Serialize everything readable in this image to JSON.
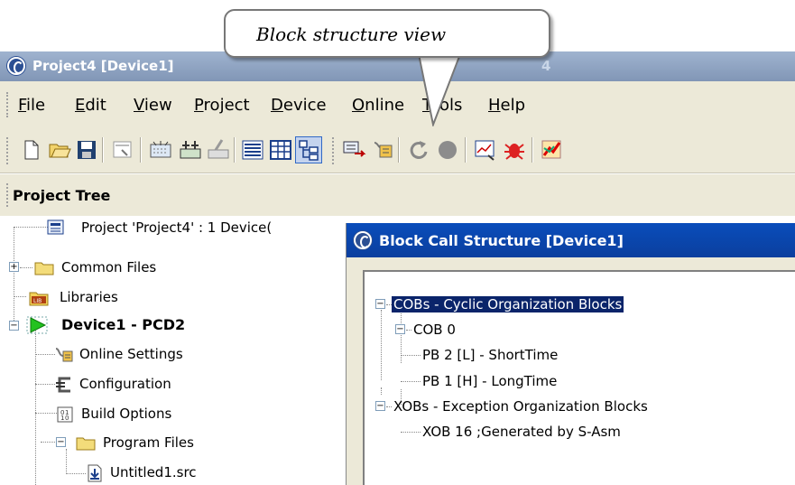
{
  "callout": {
    "text": "Block structure view"
  },
  "window": {
    "title": "Project4 [Device1]",
    "title_tail": "4"
  },
  "menu": [
    "File",
    "Edit",
    "View",
    "Project",
    "Device",
    "Online",
    "Tools",
    "Help"
  ],
  "toolbar_icons": [
    "new-icon",
    "open-icon",
    "save-icon",
    "properties-icon",
    "build-icon",
    "build-all-icon",
    "clean-icon",
    "list-view-icon",
    "table-view-icon",
    "block-structure-icon",
    "online-settings-icon",
    "configurator-icon",
    "restart-icon",
    "stop-icon",
    "watch-window-icon",
    "debugger-icon",
    "fupla-icon"
  ],
  "project_tree": {
    "header": "Project Tree"
  },
  "tree": {
    "project": "Project 'Project4' : 1 Device(",
    "common_files": "Common Files",
    "libraries": "Libraries",
    "device": "Device1 - PCD2",
    "online_settings": "Online Settings",
    "configuration": "Configuration",
    "build_options": "Build Options",
    "program_files": "Program Files",
    "untitled": "Untitled1.src"
  },
  "block_call": {
    "title": "Block Call Structure [Device1]",
    "cobs": "COBs - Cyclic Organization Blocks",
    "cob0": "COB 0",
    "pb2": "PB 2 [L] - ShortTime",
    "pb1": "PB 1 [H] - LongTime",
    "xobs": "XOBs - Exception Organization Blocks",
    "xob16": "XOB 16  ;Generated by S-Asm"
  }
}
